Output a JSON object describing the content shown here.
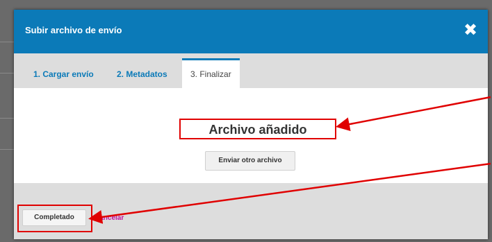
{
  "modal": {
    "title": "Subir archivo de envío",
    "close_icon": "close-icon",
    "header_color": "#0b7ab8"
  },
  "tabs": [
    {
      "label": "1. Cargar envío",
      "active": false,
      "color": "#0b7ab8"
    },
    {
      "label": "2. Metadatos",
      "active": false,
      "color": "#0b7ab8"
    },
    {
      "label": "3. Finalizar",
      "active": true,
      "color": "#444444"
    }
  ],
  "content": {
    "status_heading": "Archivo añadido",
    "upload_another_label": "Enviar otro archivo"
  },
  "footer": {
    "done_label": "Completado",
    "cancel_label": "Cancelar",
    "cancel_color": "#c0119f"
  },
  "annotations": {
    "highlight_color": "#e00000",
    "arrow_color": "#e00000"
  }
}
